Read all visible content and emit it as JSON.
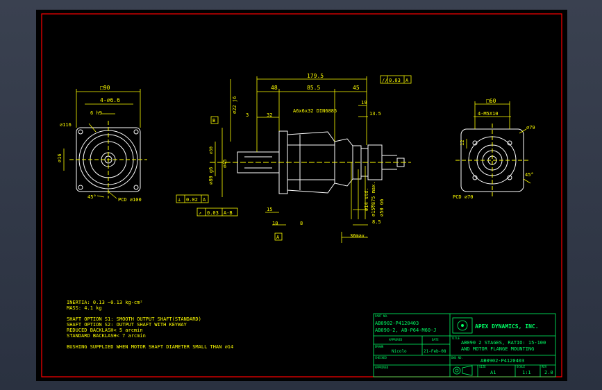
{
  "colors": {
    "background": "#000000",
    "frame": "#ff0000",
    "geometry": "#ffffff",
    "dimension": "#ffff00",
    "title_block": "#00ff66",
    "window_bg": "#2f3745"
  },
  "left_view": {
    "square": "□90",
    "holes": "4-⌀6.6",
    "keyway": "6 h9",
    "outer_dia": "⌀116",
    "face_dia": "⌀16",
    "angle": "45°",
    "pcd": "PCD ⌀100"
  },
  "center_view": {
    "overall": "179.5",
    "seg_48": "48",
    "seg_855": "85.5",
    "seg_45": "45",
    "len_32": "32",
    "len_3": "3",
    "key": "A6x6x32 DIN6885",
    "len_19": "19",
    "len_135": "13.5",
    "shaft_dia": "⌀22 j6",
    "dia_30": "⌀30",
    "pilot_dia": "⌀80 g6",
    "dia_45": "⌀45",
    "bore_dia": "⌀14 std.",
    "bore_max": "⌀15.875 max.",
    "motor_dia": "⌀50 G6",
    "len_15": "15",
    "len_10": "10",
    "len_8": "8",
    "len_85": "8.5",
    "len_8b": "8",
    "len_36": "36max.",
    "datum_a": "A",
    "datum_b": "B",
    "tol_parallel_sym": "//",
    "tol_parallel_val": "0.03",
    "tol_parallel_ref": "A",
    "tol_flat_sym": "⊥",
    "tol_flat_val": "0.02",
    "tol_flat_ref": "A",
    "tol_runout_sym": "↗",
    "tol_runout_val": "0.03",
    "tol_runout_ref": "A-B"
  },
  "right_view": {
    "square": "□60",
    "holes": "4-M5X10",
    "dia_79": "⌀79",
    "dim_12": "12",
    "angle": "45°",
    "pcd": "PCD ⌀70"
  },
  "notes": [
    "INERTIA:  0.13 ~0.13 kg-cm²",
    "MASS: 4.1 kg",
    "",
    "SHAFT OPTION S1: SMOOTH OUTPUT SHAFT(STANDARD)",
    "SHAFT OPTION S2: OUTPUT SHAFT WITH KEYWAY",
    "REDUCED BACKLASH< 5 arcmin",
    "STANDARD BACKLASH< 7 arcmin",
    "",
    "BUSHING SUPPLIED WHEN MOTOR SHAFT DIAMETER SMALL THAN ⌀14"
  ],
  "title_block": {
    "part_no_label": "PART NO.",
    "part_no_1": "AB0902-P4120403",
    "part_no_2": "AB090-2, AB-P64-M60-J",
    "approved_label": "APPROVED",
    "date_label": "DATE",
    "drawn_label": "DRAWN",
    "drawn_by": "Nicolo",
    "drawn_date": "21-Feb-08",
    "dwg_no_label": "DWG NO.",
    "checked_label": "CHECKED",
    "company": "APEX DYNAMICS, INC.",
    "title_label": "TITLE",
    "title_1": "AB090 2 STAGES, RATIO: 15-100",
    "title_2": "AND MOTOR FLANGE MOUNTING",
    "dwg_no": "AB0902-P4120403",
    "size_label": "SIZE",
    "size": "A1",
    "scale_label": "SCALE",
    "scale": "1:1",
    "rev_label": "REV",
    "rev": "2.0"
  }
}
